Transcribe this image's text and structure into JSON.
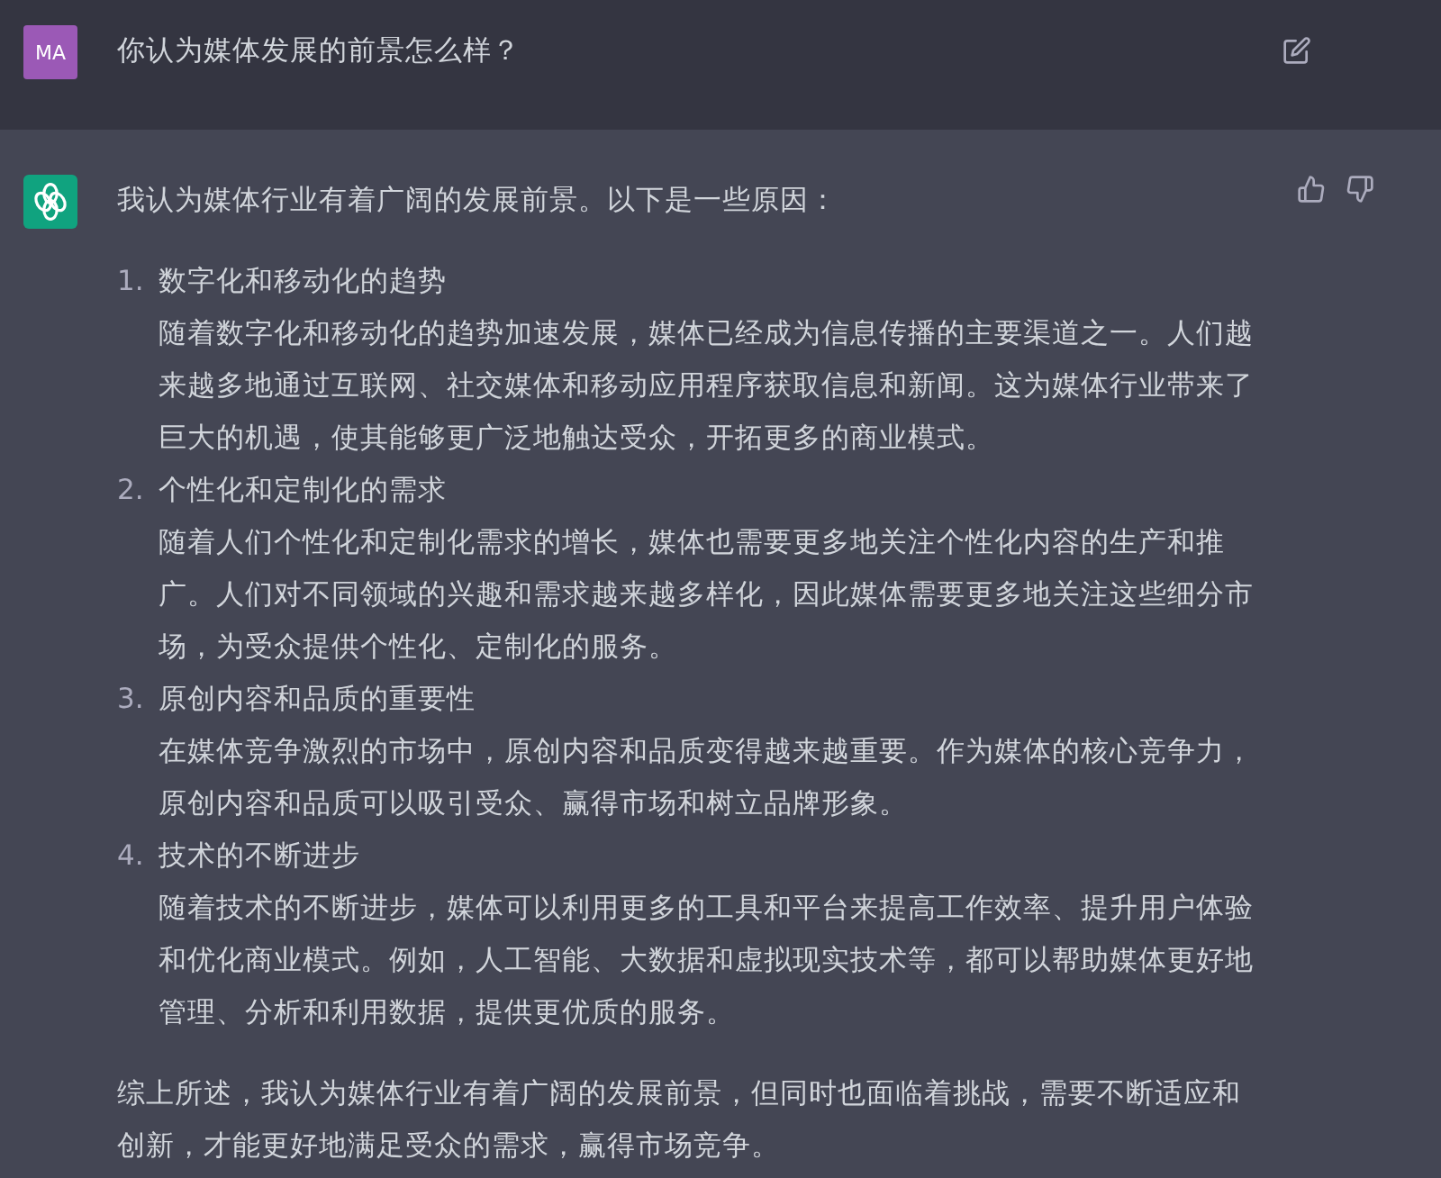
{
  "user_message": {
    "avatar": "MA",
    "text": "你认为媒体发展的前景怎么样？"
  },
  "assistant_message": {
    "intro": "我认为媒体行业有着广阔的发展前景。以下是一些原因：",
    "items": [
      {
        "number": "1.",
        "title": "数字化和移动化的趋势",
        "body": "随着数字化和移动化的趋势加速发展，媒体已经成为信息传播的主要渠道之一。人们越来越多地通过互联网、社交媒体和移动应用程序获取信息和新闻。这为媒体行业带来了巨大的机遇，使其能够更广泛地触达受众，开拓更多的商业模式。"
      },
      {
        "number": "2.",
        "title": "个性化和定制化的需求",
        "body": "随着人们个性化和定制化需求的增长，媒体也需要更多地关注个性化内容的生产和推广。人们对不同领域的兴趣和需求越来越多样化，因此媒体需要更多地关注这些细分市场，为受众提供个性化、定制化的服务。"
      },
      {
        "number": "3.",
        "title": "原创内容和品质的重要性",
        "body": "在媒体竞争激烈的市场中，原创内容和品质变得越来越重要。作为媒体的核心竞争力，原创内容和品质可以吸引受众、赢得市场和树立品牌形象。"
      },
      {
        "number": "4.",
        "title": "技术的不断进步",
        "body": "随着技术的不断进步，媒体可以利用更多的工具和平台来提高工作效率、提升用户体验和优化商业模式。例如，人工智能、大数据和虚拟现实技术等，都可以帮助媒体更好地管理、分析和利用数据，提供更优质的服务。"
      }
    ],
    "conclusion": "综上所述，我认为媒体行业有着广阔的发展前景，但同时也面临着挑战，需要不断适应和创新，才能更好地满足受众的需求，赢得市场竞争。"
  }
}
